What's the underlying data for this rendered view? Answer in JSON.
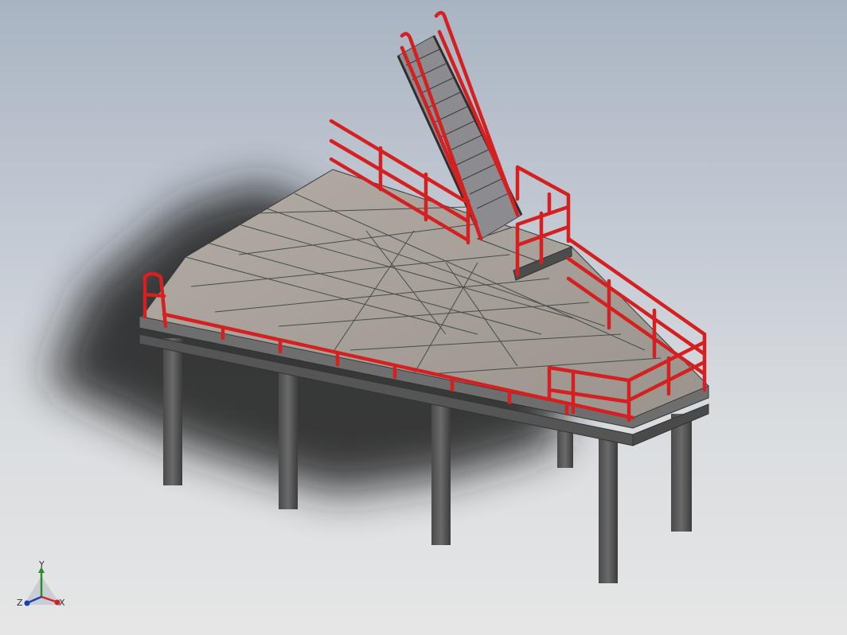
{
  "viewport": {
    "background_top": "#a9b4c2",
    "background_bottom": "#e6e6e6"
  },
  "model": {
    "railing_color": "#d42020",
    "deck_color": "#a49e96",
    "steel_color": "#5a5a5a",
    "shadow_color": "#1e1e1e"
  },
  "triad": {
    "x_label": "X",
    "y_label": "Y",
    "z_label": "Z",
    "x_color": "#c62828",
    "y_color": "#2e8b2e",
    "z_color": "#1e3fae"
  }
}
